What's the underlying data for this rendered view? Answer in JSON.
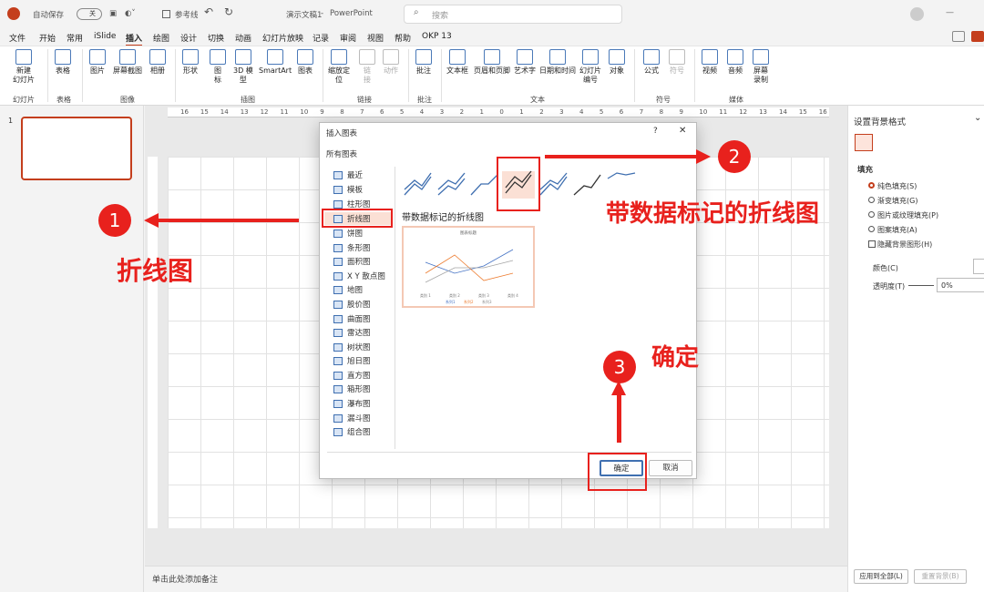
{
  "titlebar": {
    "autosave": "自动保存",
    "toggle": "关",
    "filename": "演示文稿1",
    "app": "PowerPoint",
    "sep": "-",
    "checkbox_label": "参考线",
    "search_placeholder": "搜索"
  },
  "menu": [
    "文件",
    "开始",
    "常用",
    "iSlide",
    "插入",
    "绘图",
    "设计",
    "切换",
    "动画",
    "幻灯片放映",
    "记录",
    "审阅",
    "视图",
    "帮助",
    "OKP 13"
  ],
  "ribbon": {
    "items": [
      "新建\n幻灯片",
      "表格",
      "图片",
      "屏幕截图",
      "相册",
      "形状",
      "图\n标",
      "3D 模\n型",
      "SmartArt",
      "图表",
      "缩放定\n位",
      "链\n接",
      "动作",
      "批注",
      "文本框",
      "页眉和页脚",
      "艺术字",
      "日期和时间",
      "幻灯片\n编号",
      "对象",
      "公式",
      "符号",
      "视频",
      "音频",
      "屏幕\n录制"
    ],
    "groups": [
      "幻灯片",
      "表格",
      "图像",
      "插图",
      "链接",
      "批注",
      "文本",
      "符号",
      "媒体"
    ]
  },
  "ruler_ticks": [
    "16",
    "15",
    "14",
    "13",
    "12",
    "11",
    "10",
    "9",
    "8",
    "7",
    "6",
    "5",
    "4",
    "3",
    "2",
    "1",
    "0",
    "1",
    "2",
    "3",
    "4",
    "5",
    "6",
    "7",
    "8",
    "9",
    "10",
    "11",
    "12",
    "13",
    "14",
    "15",
    "16"
  ],
  "slide_number": "1",
  "notes": "单击此处添加备注",
  "rightpane": {
    "title": "设置背景格式",
    "section": "填充",
    "options": [
      "纯色填充(S)",
      "渐变填充(G)",
      "图片或纹理填充(P)",
      "图案填充(A)"
    ],
    "hide": "隐藏背景图形(H)",
    "color": "颜色(C)",
    "transparency": "透明度(T)",
    "transparency_value": "0%",
    "apply_all": "应用到全部(L)",
    "reset": "重置背景(B)"
  },
  "dialog": {
    "title": "插入图表",
    "help": "?",
    "close": "✕",
    "tab": "所有图表",
    "categories": [
      "最近",
      "模板",
      "柱形图",
      "折线图",
      "饼图",
      "条形图",
      "面积图",
      "X Y 散点图",
      "地图",
      "股价图",
      "曲面图",
      "雷达图",
      "树状图",
      "旭日图",
      "直方图",
      "箱形图",
      "瀑布图",
      "漏斗图",
      "组合图"
    ],
    "subtype": "带数据标记的折线图",
    "preview_title": "图表标题",
    "preview_cats": [
      "类别 1",
      "类别 2",
      "类别 3",
      "类别 4"
    ],
    "preview_legend": [
      "系列1",
      "系列2",
      "系列3"
    ],
    "ok": "确定",
    "cancel": "取消"
  },
  "annotations": {
    "n1": "1",
    "n2": "2",
    "n3": "3",
    "label1": "折线图",
    "label2": "带数据标记的折线图",
    "label3": "确定"
  },
  "colors": {
    "accent": "#c43e1c",
    "annotation": "#e8211d"
  }
}
